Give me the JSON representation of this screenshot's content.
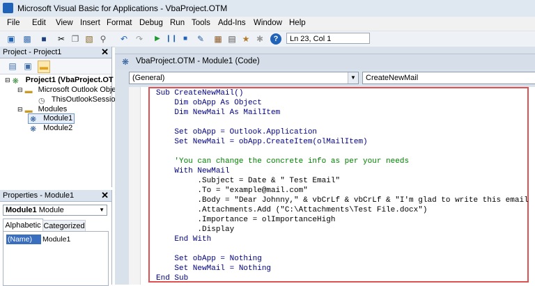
{
  "window": {
    "title": "Microsoft Visual Basic for Applications - VbaProject.OTM"
  },
  "menu": [
    "File",
    "Edit",
    "View",
    "Insert",
    "Format",
    "Debug",
    "Run",
    "Tools",
    "Add-Ins",
    "Window",
    "Help"
  ],
  "toolbar": {
    "status": "Ln 23, Col 1"
  },
  "project": {
    "title": "Project - Project1",
    "tree": {
      "root": "Project1 (VbaProject.OT",
      "folder1": "Microsoft Outlook Object",
      "session": "ThisOutlookSession",
      "modules": "Modules",
      "module1": "Module1",
      "module2": "Module2"
    }
  },
  "properties": {
    "title": "Properties - Module1",
    "object_name": "Module1",
    "object_type": "Module",
    "tab_alpha": "Alphabetic",
    "tab_cat": "Categorized",
    "row_name": "(Name)",
    "row_value": "Module1"
  },
  "code_window": {
    "title": "VbaProject.OTM - Module1 (Code)",
    "object_combo": "(General)",
    "proc_combo": "CreateNewMail"
  },
  "code": {
    "l1": "Sub CreateNewMail()",
    "l2": "    Dim obApp As Object",
    "l3": "    Dim NewMail As MailItem",
    "l4": "    Set obApp = Outlook.Application",
    "l5": "    Set NewMail = obApp.CreateItem(olMailItem)",
    "l6": "    'You can change the concrete info as per your needs",
    "l7": "    With NewMail",
    "l8": "         .Subject = Date & \" Test Email\"",
    "l9": "         .To = \"example@mail.com\"",
    "l10": "         .Body = \"Dear Johnny,\" & vbCrLf & vbCrLf & \"I'm glad to write this email",
    "l11": "         .Attachments.Add (\"C:\\Attachments\\Test File.docx\")",
    "l12": "         .Importance = olImportanceHigh",
    "l13": "         .Display",
    "l14": "    End With",
    "l15": "    Set obApp = Nothing",
    "l16": "    Set NewMail = Nothing",
    "l17": "End Sub"
  }
}
